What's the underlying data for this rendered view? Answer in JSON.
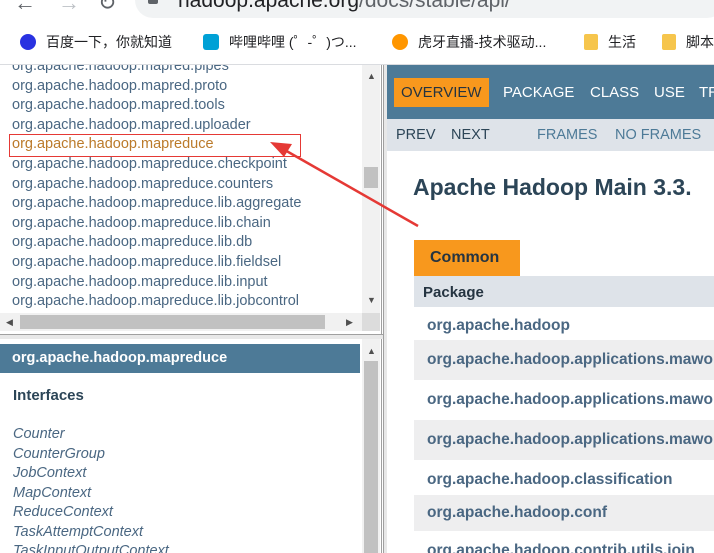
{
  "browser": {
    "url_host": "hadoop.apache.org",
    "url_path": "/docs/stable/api/",
    "bookmarks": [
      {
        "label": "百度一下，你就知道",
        "icon": "baidu-paw-icon",
        "color": "#2932e1"
      },
      {
        "label": "哔哩哔哩 (゜-゜)つ...",
        "icon": "bilibili-tv-icon",
        "color": "#00a1d6"
      },
      {
        "label": "虎牙直播-技术驱动...",
        "icon": "huya-icon",
        "color": "#ff9600"
      },
      {
        "label": "生活",
        "icon": "folder-icon",
        "color": "#f6c54c"
      },
      {
        "label": "脚本",
        "icon": "folder-icon",
        "color": "#f6c54c"
      }
    ]
  },
  "package_list": {
    "items": [
      "org.apache.hadoop.mapred.pipes",
      "org.apache.hadoop.mapred.proto",
      "org.apache.hadoop.mapred.tools",
      "org.apache.hadoop.mapred.uploader",
      "org.apache.hadoop.mapreduce",
      "org.apache.hadoop.mapreduce.checkpoint",
      "org.apache.hadoop.mapreduce.counters",
      "org.apache.hadoop.mapreduce.lib.aggregate",
      "org.apache.hadoop.mapreduce.lib.chain",
      "org.apache.hadoop.mapreduce.lib.db",
      "org.apache.hadoop.mapreduce.lib.fieldsel",
      "org.apache.hadoop.mapreduce.lib.input",
      "org.apache.hadoop.mapreduce.lib.jobcontrol"
    ],
    "selected_index": 4
  },
  "class_frame": {
    "title": "org.apache.hadoop.mapreduce",
    "heading": "Interfaces",
    "interfaces": [
      "Counter",
      "CounterGroup",
      "JobContext",
      "MapContext",
      "ReduceContext",
      "TaskAttemptContext",
      "TaskInputOutputContext"
    ]
  },
  "main": {
    "nav": [
      "OVERVIEW",
      "PACKAGE",
      "CLASS",
      "USE",
      "TREE"
    ],
    "subnav": [
      "PREV",
      "NEXT",
      "FRAMES",
      "NO FRAMES"
    ],
    "title": "Apache Hadoop Main 3.3.",
    "tab": "Common",
    "table_header": "Package",
    "packages": [
      "org.apache.hadoop",
      "org.apache.hadoop.applications.mawo",
      "org.apache.hadoop.applications.mawo",
      "org.apache.hadoop.applications.mawo",
      "org.apache.hadoop.classification",
      "org.apache.hadoop.conf",
      "org.apache.hadoop.contrib.utils.join"
    ]
  },
  "colors": {
    "annotation": "#e53935",
    "header_blue": "#4d7a97",
    "accent_orange": "#f8981d"
  }
}
